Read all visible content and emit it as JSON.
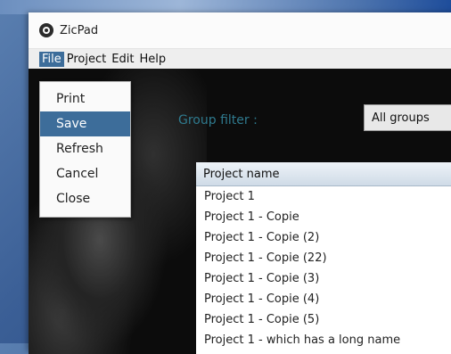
{
  "window": {
    "title": "ZicPad"
  },
  "menubar": {
    "items": [
      "File",
      "Project",
      "Edit",
      "Help"
    ],
    "active_index": 0
  },
  "file_menu": {
    "items": [
      "Print",
      "Save",
      "Refresh",
      "Cancel",
      "Close"
    ],
    "selected_index": 1
  },
  "filter": {
    "label": "Group filter :",
    "value": "All groups"
  },
  "table": {
    "columns": [
      "Project name"
    ],
    "rows": [
      "Project 1",
      "Project 1 - Copie",
      "Project 1 - Copie (2)",
      "Project 1 - Copie (22)",
      "Project 1 - Copie (3)",
      "Project 1 - Copie (4)",
      "Project 1 - Copie (5)",
      "Project 1 - which has a long name"
    ]
  },
  "colors": {
    "accent": "#3d6d9a",
    "filter_label": "#2f7a8e",
    "content_bg": "#0c0c0c"
  },
  "icons": {
    "app": "zicpad-app-icon"
  }
}
